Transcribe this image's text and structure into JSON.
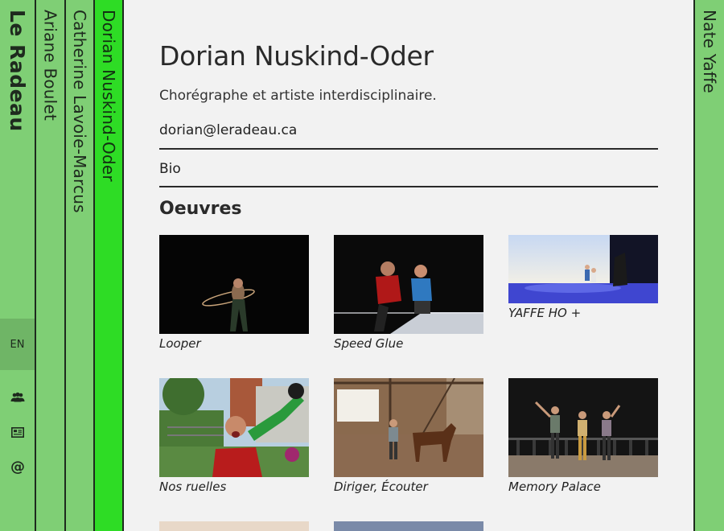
{
  "sidebar": {
    "brand": "Le Radeau",
    "artists": [
      "Ariane Boulet",
      "Catherine Lavoie-Marcus",
      "Dorian Nuskind-Oder"
    ],
    "right_artist": "Nate Yaffe",
    "lang": "EN",
    "icons": [
      "people-icon",
      "news-icon",
      "at-icon"
    ],
    "at_glyph": "@"
  },
  "profile": {
    "name": "Dorian Nuskind-Oder",
    "subtitle": "Chorégraphe et artiste interdisciplinaire.",
    "email": "dorian@leradeau.ca",
    "bio_label": "Bio",
    "works_heading": "Oeuvres"
  },
  "works": [
    {
      "title": "Looper"
    },
    {
      "title": "Speed Glue"
    },
    {
      "title": "YAFFE HO +"
    },
    {
      "title": "Nos ruelles"
    },
    {
      "title": "Diriger, Écouter"
    },
    {
      "title": "Memory Palace"
    }
  ],
  "colors": {
    "strip": "#7fcf75",
    "strip_active": "#2edc25",
    "background": "#f2f2f2"
  }
}
